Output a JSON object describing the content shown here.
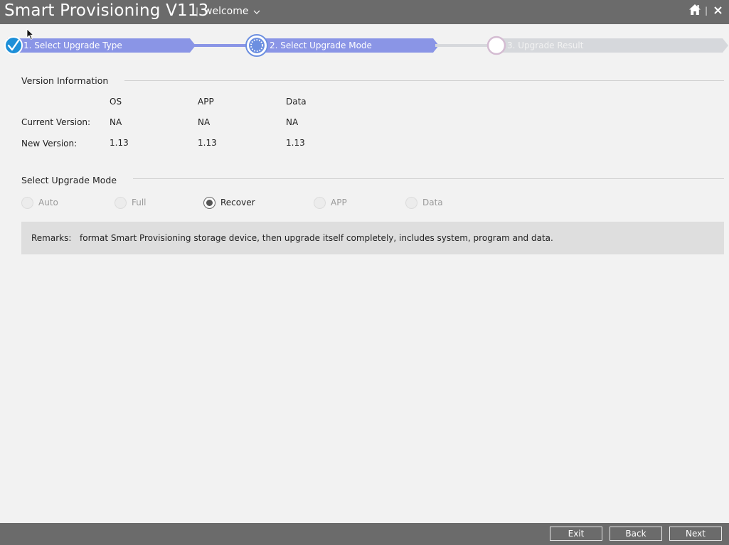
{
  "titlebar": {
    "app_title": "Smart Provisioning V113",
    "separator": "|",
    "user": "welcome",
    "icons": [
      "home-icon",
      "close-icon",
      "chevron-down-icon"
    ]
  },
  "stepper": {
    "steps": [
      {
        "label": "1. Select Upgrade Type",
        "state": "completed"
      },
      {
        "label": "2. Select Upgrade Mode",
        "state": "active"
      },
      {
        "label": "3. Upgrade Result",
        "state": "pending"
      }
    ],
    "colors": {
      "active": "#8a95e6",
      "pending": "#d6d8dc",
      "check": "#1d8fd8"
    }
  },
  "version_info": {
    "title": "Version Information",
    "columns": [
      "OS",
      "APP",
      "Data"
    ],
    "rows": [
      {
        "label": "Current Version:",
        "values": [
          "NA",
          "NA",
          "NA"
        ]
      },
      {
        "label": "New Version:",
        "values": [
          "1.13",
          "1.13",
          "1.13"
        ]
      }
    ]
  },
  "upgrade_mode": {
    "title": "Select Upgrade Mode",
    "options": [
      {
        "label": "Auto",
        "enabled": false,
        "selected": false
      },
      {
        "label": "Full",
        "enabled": false,
        "selected": false
      },
      {
        "label": "Recover",
        "enabled": true,
        "selected": true
      },
      {
        "label": "APP",
        "enabled": false,
        "selected": false
      },
      {
        "label": "Data",
        "enabled": false,
        "selected": false
      }
    ]
  },
  "remarks": {
    "label": "Remarks:",
    "text": "format Smart Provisioning storage device, then upgrade itself completely, includes system, program and data."
  },
  "footer": {
    "exit_label": "Exit",
    "back_label": "Back",
    "next_label": "Next"
  }
}
